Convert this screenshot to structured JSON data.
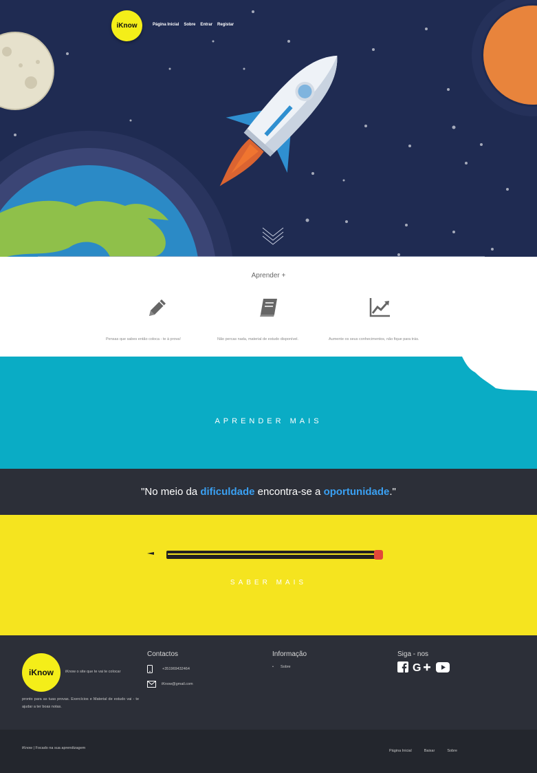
{
  "header": {
    "logo_prefix": "i",
    "logo_suffix": "Know",
    "nav": [
      "Página Inicial",
      "Sobre",
      "Entrar",
      "Registar"
    ]
  },
  "features": {
    "title": "Aprender +",
    "items": [
      {
        "icon": "pencil-icon",
        "text": "Pensas que sabes então coloca - te à prova!"
      },
      {
        "icon": "book-icon",
        "text": "Não percas nada, material de estudo disponível."
      },
      {
        "icon": "chart-line-icon",
        "text": "Aumente os seus conhecimentos, não fique para trás."
      }
    ]
  },
  "teal": {
    "button": "APRENDER MAIS"
  },
  "quote": {
    "part1": "\"No meio da ",
    "hl1": "dificuldade",
    "part2": " encontra-se a ",
    "hl2": "oportunidade",
    "part3": ".\""
  },
  "yellow": {
    "button": "SABER MAIS"
  },
  "footer": {
    "logo_prefix": "i",
    "logo_suffix": "Know",
    "desc1": "iKnow o site que te vai te colocar",
    "desc2": "pronto para as tuas provas. Exercícios e Material de estudo vai - te ajudar a ter boas notas.",
    "contacts_title": "Contactos",
    "phone": "+351969432464",
    "email": "iKnow@gmail.com",
    "info_title": "Informação",
    "info_items": [
      "Sobre"
    ],
    "follow_title": "Siga - nos",
    "socials": [
      "facebook-icon",
      "google-plus-icon",
      "youtube-icon"
    ]
  },
  "bottom": {
    "copyright": "iKnow | Focado na sua aprendizagem",
    "links": [
      "Página Inicial",
      "Baixar",
      "Sobre"
    ]
  },
  "colors": {
    "hero_bg": "#1f2b52",
    "teal": "#0aacc5",
    "dark": "#2c2f38",
    "yellow": "#f5e41f",
    "highlight": "#3aa0f2",
    "logo": "#f4ee19"
  }
}
